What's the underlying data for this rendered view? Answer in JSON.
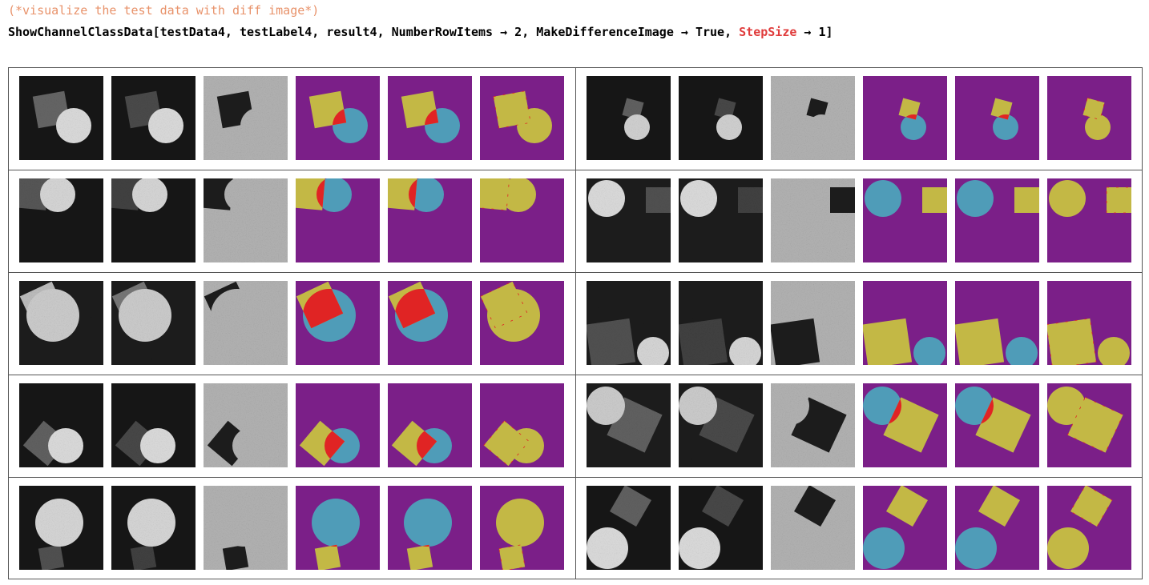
{
  "comment": "(*visualize the test data with diff image*)",
  "code": {
    "function": "ShowChannelClassData",
    "open": "[",
    "args_before": "testData4, testLabel4, result4, NumberRowItems",
    "arrow": "→",
    "value1": "2",
    "sep1": ", MakeDifferenceImage ",
    "value2": "True",
    "sep2": ", ",
    "stepsize_label": "StepSize",
    "value3": "1",
    "close": "]"
  },
  "colors": {
    "background_class": "#7b1f88",
    "square_class": "#c3b845",
    "circle_class": "#4f9cb8",
    "error": "#e02424"
  },
  "panels": [
    {
      "sq": {
        "x": 40,
        "y": 42,
        "w": 40,
        "r": -10,
        "b": 100
      },
      "ci": {
        "x": 68,
        "y": 62,
        "r": 22,
        "b": 215
      },
      "bg": 25
    },
    {
      "sq": {
        "x": 58,
        "y": 41,
        "w": 22,
        "r": 15,
        "b": 95
      },
      "ci": {
        "x": 63,
        "y": 64,
        "r": 16,
        "b": 205
      },
      "bg": 25
    },
    {
      "sq": {
        "x": 15,
        "y": 18,
        "w": 40,
        "r": 5,
        "b": 85
      },
      "ci": {
        "x": 48,
        "y": 20,
        "r": 22,
        "b": 210
      },
      "bg": 25
    },
    {
      "sq": {
        "x": 90,
        "y": 27,
        "w": 32,
        "r": 0,
        "b": 80
      },
      "ci": {
        "x": 25,
        "y": 25,
        "r": 23,
        "b": 215
      },
      "bg": 28
    },
    {
      "sq": {
        "x": 30,
        "y": 30,
        "w": 44,
        "r": -25,
        "b": 185
      },
      "ci": {
        "x": 42,
        "y": 43,
        "r": 33,
        "b": 200
      },
      "bg": 28
    },
    {
      "sq": {
        "x": 30,
        "y": 78,
        "w": 55,
        "r": -8,
        "b": 80
      },
      "ci": {
        "x": 83,
        "y": 90,
        "r": 20,
        "b": 210
      },
      "bg": 28
    },
    {
      "sq": {
        "x": 33,
        "y": 75,
        "w": 40,
        "r": 40,
        "b": 95
      },
      "ci": {
        "x": 58,
        "y": 78,
        "r": 22,
        "b": 215
      },
      "bg": 25
    },
    {
      "sq": {
        "x": 60,
        "y": 52,
        "w": 52,
        "r": 25,
        "b": 95
      },
      "ci": {
        "x": 24,
        "y": 28,
        "r": 24,
        "b": 200
      },
      "bg": 28
    },
    {
      "sq": {
        "x": 40,
        "y": 90,
        "w": 28,
        "r": -10,
        "b": 80
      },
      "ci": {
        "x": 50,
        "y": 46,
        "r": 30,
        "b": 210
      },
      "bg": 25
    },
    {
      "sq": {
        "x": 55,
        "y": 25,
        "w": 38,
        "r": 30,
        "b": 95
      },
      "ci": {
        "x": 26,
        "y": 78,
        "r": 26,
        "b": 215
      },
      "bg": 25
    }
  ]
}
